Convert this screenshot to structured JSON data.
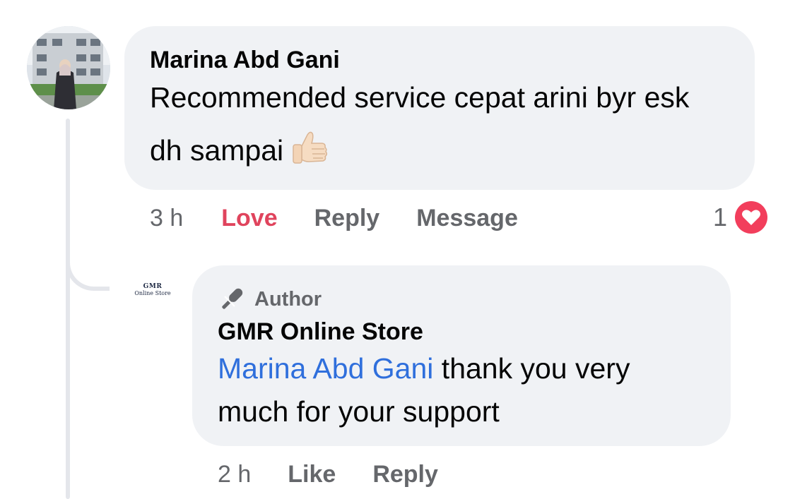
{
  "comment": {
    "author": "Marina Abd Gani",
    "text": "Recommended service cepat arini byr esk dh sampai",
    "emoji_icon": "thumbs-up-icon",
    "time": "3 h",
    "actions": {
      "love": "Love",
      "reply": "Reply",
      "message": "Message"
    },
    "reaction_count": "1",
    "reaction_icon": "heart-icon",
    "love_color": "#e0445d"
  },
  "reply": {
    "avatar_line1": "GMR",
    "avatar_line2": "Online Store",
    "badge": "Author",
    "badge_icon": "microphone-icon",
    "author": "GMR Online Store",
    "mention": "Marina Abd Gani",
    "text": " thank you very much for your support",
    "time": "2 h",
    "actions": {
      "like": "Like",
      "reply": "Reply"
    },
    "mention_color": "#2f6fdc"
  },
  "colors": {
    "bubble_bg": "#f0f2f5",
    "secondary_text": "#65676b",
    "heart": "#f23e5c"
  }
}
